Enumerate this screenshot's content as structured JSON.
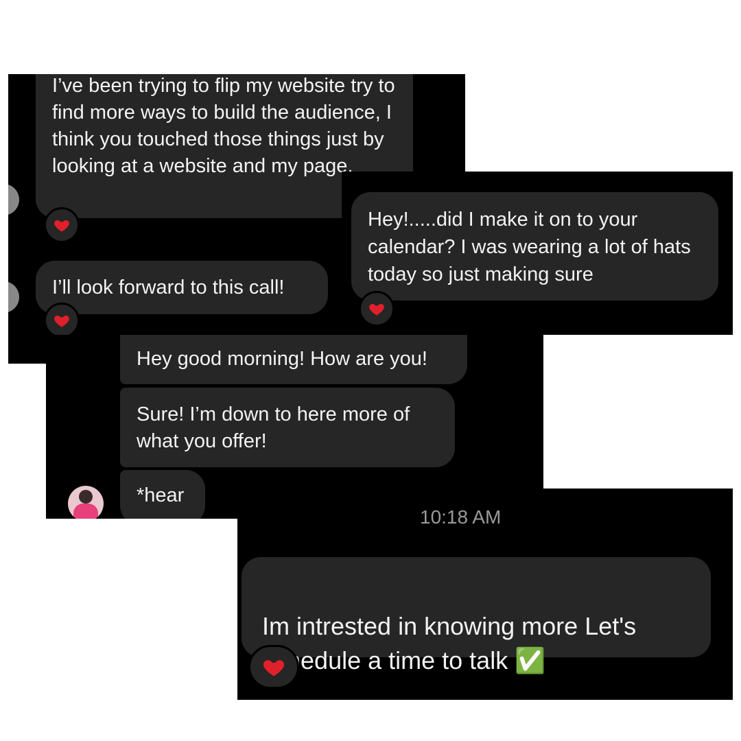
{
  "messages": {
    "m1": "I’ve been trying to flip my website try to find more ways to build the audience, I think you touched those things just by looking at a website and my page.",
    "m2": "I’ll look forward to this call!",
    "m3": "Hey!.....did I make it on to your calendar?   I was  wearing a lot of hats today so just making sure",
    "m4": "Hey good morning! How are you!",
    "m5": "Sure! I’m down to here more of what you offer!",
    "m6": "*hear",
    "m7": "Im intrested in knowing more Let's schedule a time to talk ✅"
  },
  "timestamp": "10:18 AM",
  "reaction": {
    "icon": "heart-icon",
    "color": "#e0202b"
  },
  "colors": {
    "bubble": "#262626",
    "panel": "#000000",
    "timestamp": "#9a9a9a"
  }
}
